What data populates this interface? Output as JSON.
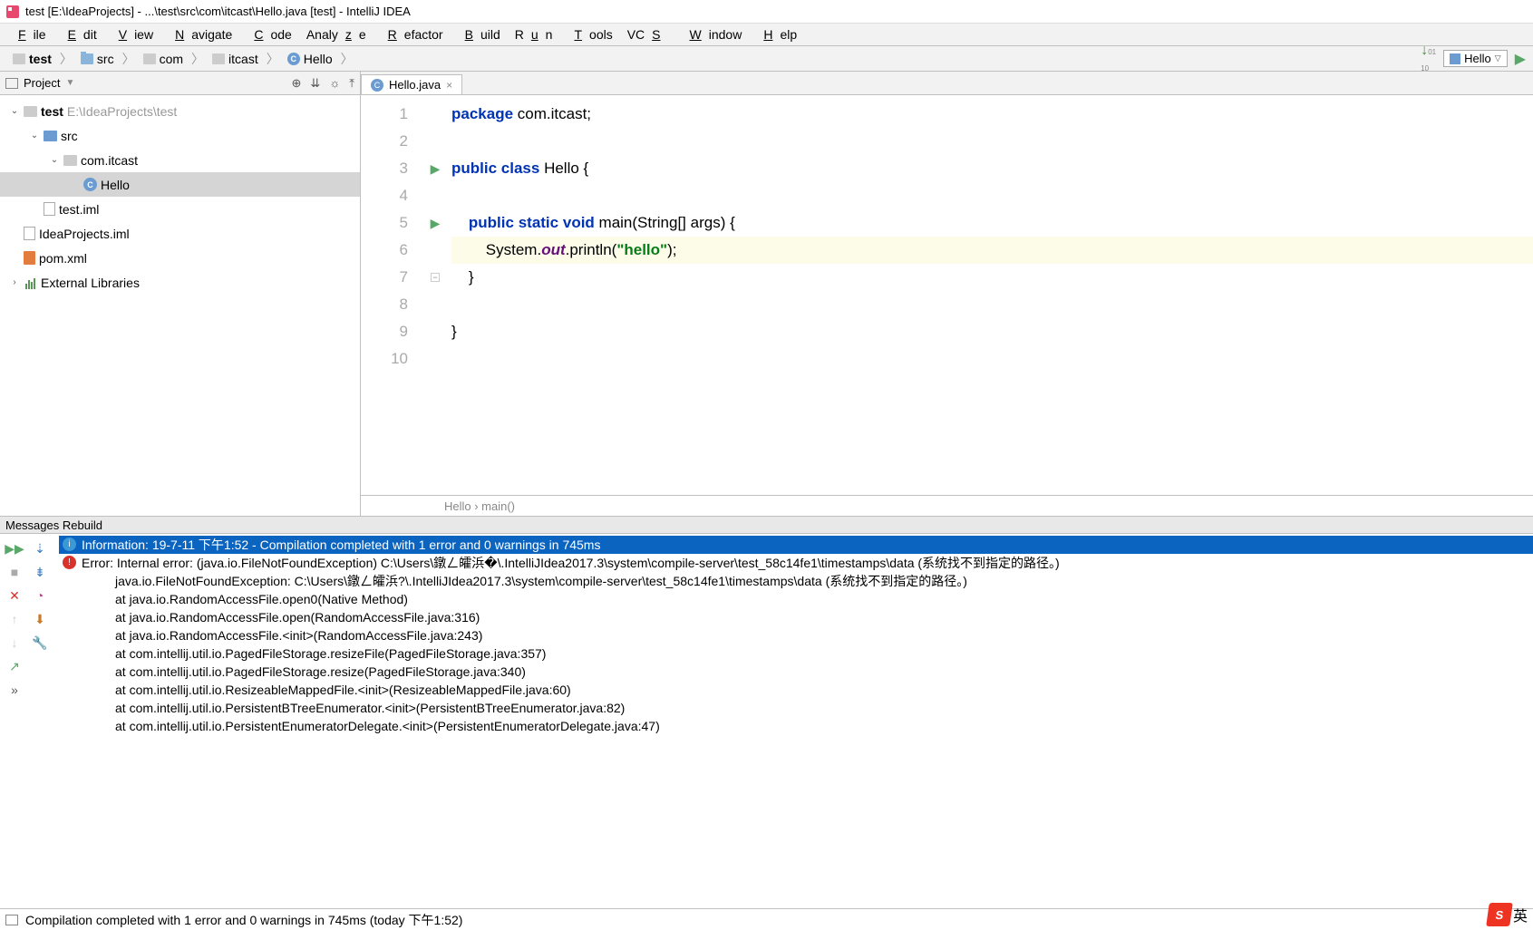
{
  "title": "test [E:\\IdeaProjects] - ...\\test\\src\\com\\itcast\\Hello.java [test] - IntelliJ IDEA",
  "menu": [
    "File",
    "Edit",
    "View",
    "Navigate",
    "Code",
    "Analyze",
    "Refactor",
    "Build",
    "Run",
    "Tools",
    "VCS",
    "Window",
    "Help"
  ],
  "breadcrumbs": [
    {
      "icon": "pkg",
      "label": "test"
    },
    {
      "icon": "folder",
      "label": "src"
    },
    {
      "icon": "pkg",
      "label": "com"
    },
    {
      "icon": "pkg",
      "label": "itcast"
    },
    {
      "icon": "class",
      "label": "Hello"
    }
  ],
  "run_config": "Hello",
  "project": {
    "header": "Project",
    "nodes": [
      {
        "depth": 0,
        "tw": "v",
        "icon": "pkg",
        "label": "test",
        "suffix": "E:\\IdeaProjects\\test",
        "bold": true
      },
      {
        "depth": 1,
        "tw": "v",
        "icon": "folder-src",
        "label": "src"
      },
      {
        "depth": 2,
        "tw": "v",
        "icon": "pkg",
        "label": "com.itcast"
      },
      {
        "depth": 3,
        "tw": "",
        "icon": "class",
        "label": "Hello",
        "selected": true
      },
      {
        "depth": 1,
        "tw": "",
        "icon": "file",
        "label": "test.iml"
      },
      {
        "depth": 0,
        "tw": "",
        "icon": "file",
        "label": "IdeaProjects.iml"
      },
      {
        "depth": 0,
        "tw": "",
        "icon": "xml",
        "label": "pom.xml"
      },
      {
        "depth": 0,
        "tw": ">",
        "icon": "lib",
        "label": "External Libraries"
      }
    ]
  },
  "editor": {
    "tab": "Hello.java",
    "breadcrumb": "Hello  ›  main()",
    "lines": [
      "1",
      "2",
      "3",
      "4",
      "5",
      "6",
      "7",
      "8",
      "9",
      "10"
    ],
    "code": {
      "l1_kw": "package",
      "l1_rest": " com.itcast;",
      "l3_kw1": "public",
      "l3_kw2": "class",
      "l3_rest": " Hello {",
      "l5_kw1": "public",
      "l5_kw2": "static",
      "l5_kw3": "void",
      "l5_rest": " main(String[] args) {",
      "l6_a": "        System.",
      "l6_out": "out",
      "l6_b": ".println(",
      "l6_str": "\"hello\"",
      "l6_c": ");",
      "l7": "    }",
      "l9": "}"
    }
  },
  "messages": {
    "title": "Messages Rebuild",
    "info": "Information: 19-7-11 下午1:52 - Compilation completed with 1 error and 0 warnings in 745ms",
    "error": "Error: Internal error: (java.io.FileNotFoundException) C:\\Users\\鐓ㄥ皬浜�\\.IntelliJIdea2017.3\\system\\compile-server\\test_58c14fe1\\timestamps\\data (系统找不到指定的路径。)",
    "trace": [
      "java.io.FileNotFoundException: C:\\Users\\鐓ㄥ皬浜?\\.IntelliJIdea2017.3\\system\\compile-server\\test_58c14fe1\\timestamps\\data (系统找不到指定的路径。)",
      "at java.io.RandomAccessFile.open0(Native Method)",
      "at java.io.RandomAccessFile.open(RandomAccessFile.java:316)",
      "at java.io.RandomAccessFile.<init>(RandomAccessFile.java:243)",
      "at com.intellij.util.io.PagedFileStorage.resizeFile(PagedFileStorage.java:357)",
      "at com.intellij.util.io.PagedFileStorage.resize(PagedFileStorage.java:340)",
      "at com.intellij.util.io.ResizeableMappedFile.<init>(ResizeableMappedFile.java:60)",
      "at com.intellij.util.io.PersistentBTreeEnumerator.<init>(PersistentBTreeEnumerator.java:82)",
      "at com.intellij.util.io.PersistentEnumeratorDelegate.<init>(PersistentEnumeratorDelegate.java:47)"
    ]
  },
  "status": "Compilation completed with 1 error and 0 warnings in 745ms (today 下午1:52)",
  "ime": "英"
}
